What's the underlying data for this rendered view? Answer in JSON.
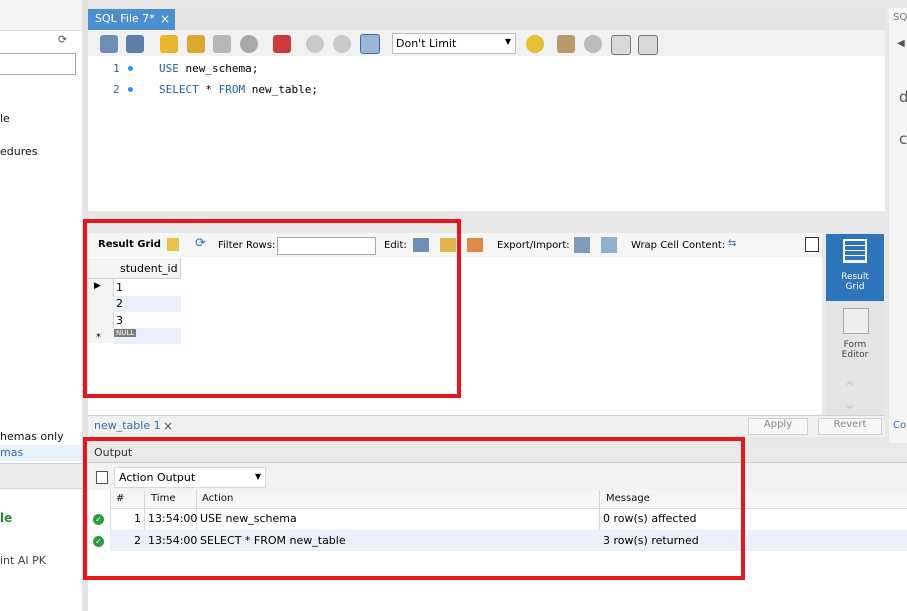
{
  "left_panel": {
    "item1": "le",
    "item2": "edures",
    "schemas_only": "hemas only",
    "tab_schemas": "mas",
    "bold_item": "le",
    "pk_item": "int AI PK"
  },
  "editor_tab": {
    "label": "SQL File 7*",
    "close": "×"
  },
  "right_panel": {
    "tab_label": "SQ",
    "letter1": "d",
    "letter2": "c",
    "bottom_text": "Co"
  },
  "toolbar": {
    "limit_value": "Don't Limit"
  },
  "editor": {
    "lines": [
      {
        "num": "1",
        "kw": "USE",
        "rest": " new_schema;"
      },
      {
        "num": "2",
        "kw": "SELECT",
        "mid": " * ",
        "kw2": "FROM",
        "rest": " new_table;"
      }
    ]
  },
  "result_toolbar": {
    "result_grid": "Result Grid",
    "filter_rows": "Filter Rows:",
    "edit": "Edit:",
    "export_import": "Export/Import:",
    "wrap": "Wrap Cell Content:"
  },
  "grid": {
    "column": "student_id",
    "rows": [
      "1",
      "2",
      "3"
    ],
    "null_label": "NULL"
  },
  "side_buttons": {
    "result_grid": "Result\nGrid",
    "form_editor": "Form\nEditor"
  },
  "lower_tabs": {
    "result_tab": "new_table 1",
    "close": "×",
    "apply": "Apply",
    "revert": "Revert"
  },
  "output": {
    "title": "Output",
    "selector": "Action Output",
    "headers": {
      "num": "#",
      "time": "Time",
      "action": "Action",
      "message": "Message"
    },
    "rows": [
      {
        "num": "1",
        "time": "13:54:00",
        "action": "USE new_schema",
        "message": "0 row(s) affected"
      },
      {
        "num": "2",
        "time": "13:54:00",
        "action": "SELECT * FROM new_table",
        "message": "3 row(s) returned"
      }
    ]
  },
  "colors": {
    "accent": "#4b8fce",
    "highlight": "#e8151b",
    "success": "#2c9b3a"
  }
}
